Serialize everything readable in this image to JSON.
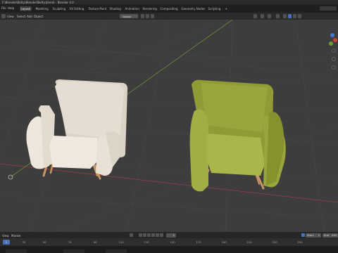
{
  "window": {
    "title": "F:\\Blender\\Betty\\Blender\\Betty.blend) - Blender 4.0"
  },
  "menu": {
    "file": "File",
    "help": "Help"
  },
  "workspace_tabs": [
    {
      "label": "Layout",
      "active": true
    },
    {
      "label": "Modeling",
      "active": false
    },
    {
      "label": "Sculpting",
      "active": false
    },
    {
      "label": "UV Editing",
      "active": false
    },
    {
      "label": "Texture Paint",
      "active": false
    },
    {
      "label": "Shading",
      "active": false
    },
    {
      "label": "Animation",
      "active": false
    },
    {
      "label": "Rendering",
      "active": false
    },
    {
      "label": "Compositing",
      "active": false
    },
    {
      "label": "Geometry Nodes",
      "active": false
    },
    {
      "label": "Scripting",
      "active": false
    }
  ],
  "toolbar": {
    "mode": "Object Mode",
    "view": "View",
    "select": "Select",
    "add": "Add",
    "object": "Object",
    "orientation": "Global",
    "drag_label": "Drag:",
    "drag_value": "Select Box",
    "options": "Options"
  },
  "viewport": {
    "grid_color": "#464646",
    "x_axis_color": "#9a3b47",
    "y_axis_color": "#6b8a3a",
    "chairs": [
      {
        "name": "white-armchair",
        "color": "#e9e1d6",
        "legs": "#c79563"
      },
      {
        "name": "green-armchair",
        "color": "#a2ad45",
        "legs": "#c79563"
      }
    ]
  },
  "timeline": {
    "view": "View",
    "marker": "Marker",
    "start_label": "Start",
    "start_value": "1",
    "end_label": "End",
    "end_value": "250",
    "current_frame": "1",
    "ruler": [
      "0",
      "30",
      "50",
      "70",
      "90",
      "110",
      "130",
      "150",
      "170",
      "190",
      "210",
      "230",
      "250"
    ]
  }
}
